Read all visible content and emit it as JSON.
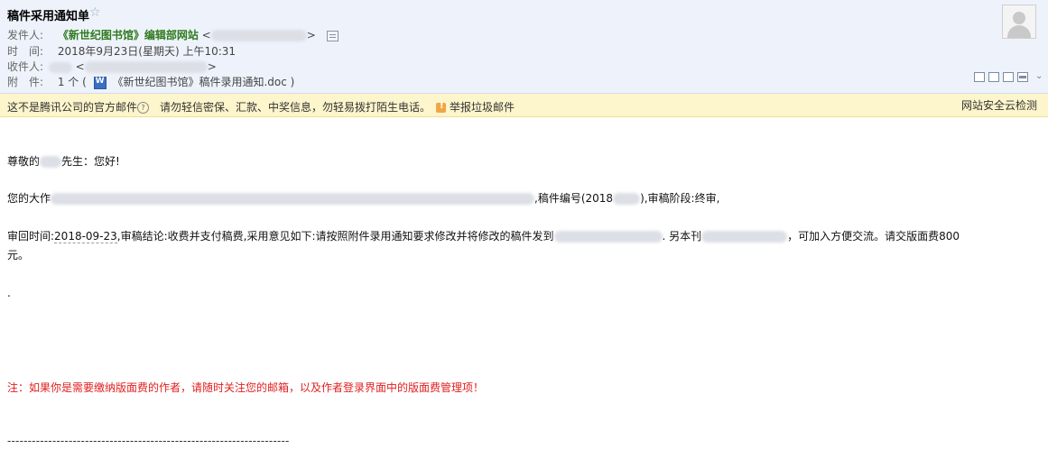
{
  "email": {
    "subject": "稿件采用通知单",
    "star_icon": "star-icon",
    "from_label": "发件人:",
    "from_name": "《新世纪图书馆》编辑部网站",
    "from_addr_open": "<",
    "from_addr_close": ">",
    "time_label": "时　间:",
    "time_value": "2018年9月23日(星期天) 上午10:31",
    "to_label": "收件人:",
    "to_addr_open": "<",
    "to_addr_close": ">",
    "attach_label": "附　件:",
    "attach_count": "1 个 (",
    "attach_name": "《新世纪图书馆》稿件录用通知.doc",
    "attach_close": ")"
  },
  "warning": {
    "text1": "这不是腾讯公司的官方邮件",
    "text2": "请勿轻信密保、汇款、中奖信息，勿轻易拨打陌生电话。",
    "report": "举报垃圾邮件",
    "site_check": "网站安全云检测"
  },
  "content": {
    "greeting_a": "尊敬的",
    "greeting_b": "先生：您好!",
    "line2_a": "您的大作",
    "line2_b": ",稿件编号(2018",
    "line2_c": "),审稿阶段:终审,",
    "line3_a": "审回时间:",
    "line3_date": "2018-09-23",
    "line3_b": ",审稿结论:收费并支付稿费,采用意见如下:请按照附件录用通知要求修改并将修改的稿件发到",
    "line3_c": ". 另本刊",
    "line3_d": "，可加入方便交流。请交版面费800",
    "line3_e": "元。",
    "dot": ".",
    "note": "注：如果你是需要缴纳版面费的作者，请随时关注您的邮箱，以及作者登录界面中的版面费管理项！",
    "dashes": "---------------------------------------------------------------------"
  }
}
